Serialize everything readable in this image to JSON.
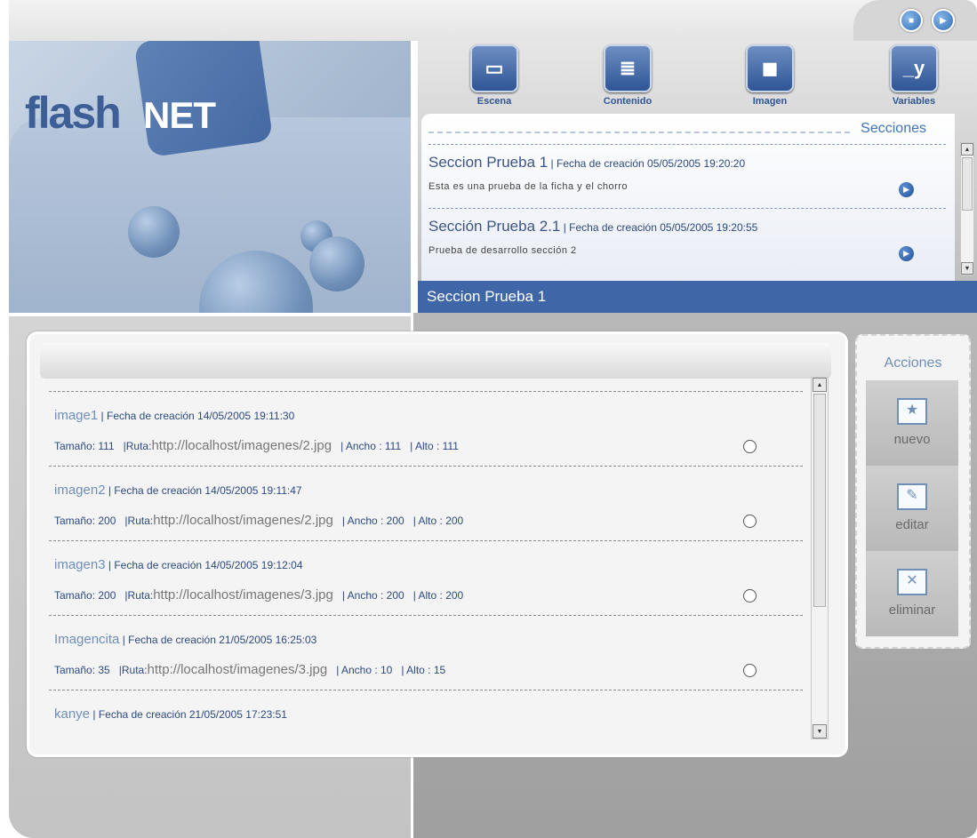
{
  "window": {
    "stop_button": "stop-icon",
    "play_button": "play-icon"
  },
  "logo": {
    "part1": "flash",
    "part2": "NET"
  },
  "toolbar": {
    "items": [
      {
        "label": "Escena",
        "icon": "scene-icon",
        "glyph": "▭"
      },
      {
        "label": "Contenido",
        "icon": "document-icon",
        "glyph": "≣"
      },
      {
        "label": "Imagen",
        "icon": "image-icon",
        "glyph": "◼"
      },
      {
        "label": "Variables",
        "icon": "variables-icon",
        "glyph": "_y"
      }
    ]
  },
  "sections": {
    "heading": "Secciones",
    "items": [
      {
        "title": "Seccion Prueba 1",
        "meta": " | Fecha de creación 05/05/2005 19:20:20",
        "desc": "Esta es una prueba de la ficha y el chorro"
      },
      {
        "title": "Sección Prueba 2.1",
        "meta": " | Fecha de creación 05/05/2005 19:20:55",
        "desc": "Prueba de desarrollo sección 2"
      }
    ],
    "selected": "Seccion Prueba 1"
  },
  "images": {
    "rows": [
      {
        "name": "image1",
        "date": " | Fecha de creación 14/05/2005 19:11:30",
        "size_label": "Tamaño: 111",
        "route_label": "|Ruta:",
        "url": "http://localhost/imagenes/2.jpg",
        "width_label": "| Ancho : 111",
        "height_label": "| Alto : 111"
      },
      {
        "name": "imagen2",
        "date": " | Fecha de creación 14/05/2005 19:11:47",
        "size_label": "Tamaño: 200",
        "route_label": "|Ruta:",
        "url": "http://localhost/imagenes/2.jpg",
        "width_label": "| Ancho : 200",
        "height_label": "| Alto : 200"
      },
      {
        "name": "imagen3",
        "date": " | Fecha de creación 14/05/2005 19:12:04",
        "size_label": "Tamaño: 200",
        "route_label": "|Ruta:",
        "url": "http://localhost/imagenes/3.jpg",
        "width_label": "| Ancho : 200",
        "height_label": "| Alto : 200"
      },
      {
        "name": "Imagencita",
        "date": " | Fecha de creación 21/05/2005 16:25:03",
        "size_label": "Tamaño: 35",
        "route_label": "|Ruta:",
        "url": "http://localhost/imagenes/3.jpg",
        "width_label": "| Ancho : 10",
        "height_label": "| Alto : 15"
      },
      {
        "name": "kanye",
        "date": " | Fecha de creación 21/05/2005 17:23:51"
      }
    ]
  },
  "actions": {
    "title": "Acciones",
    "items": [
      {
        "label": "nuevo",
        "icon": "new-icon",
        "glyph": "★"
      },
      {
        "label": "editar",
        "icon": "edit-icon",
        "glyph": "✎"
      },
      {
        "label": "eliminar",
        "icon": "delete-icon",
        "glyph": "✕"
      }
    ]
  },
  "colors": {
    "accent": "#3f67a8",
    "link": "#6f8fb8",
    "text_dark": "#2c4a80"
  }
}
